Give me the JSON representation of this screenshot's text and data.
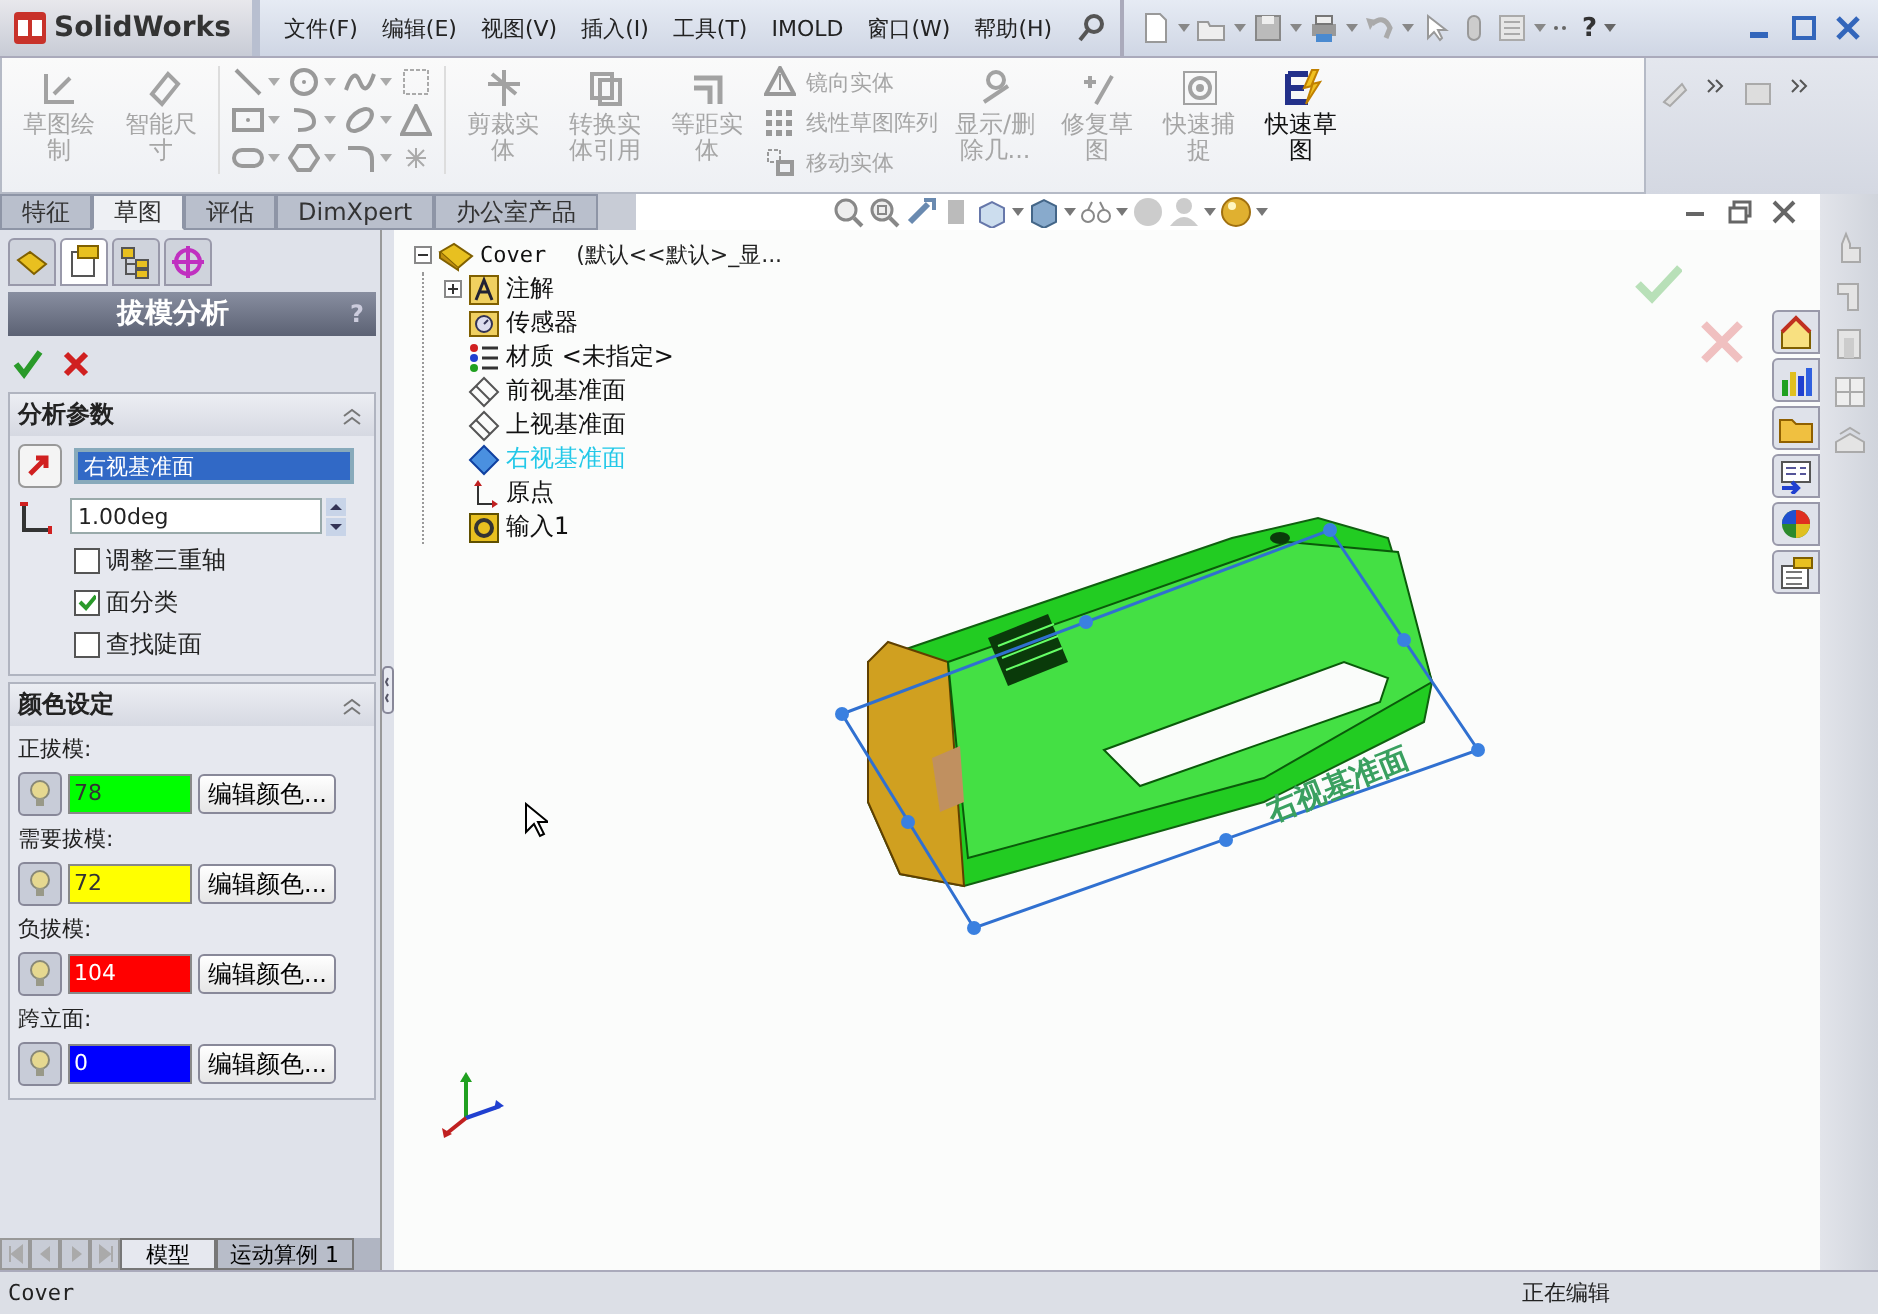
{
  "title_bar": {
    "logo": "SolidWorks",
    "menus": [
      "文件(F)",
      "编辑(E)",
      "视图(V)",
      "插入(I)",
      "工具(T)",
      "IMOLD",
      "窗口(W)",
      "帮助(H)"
    ],
    "help": "?"
  },
  "ribbon": {
    "tools": [
      {
        "kind": "large",
        "label": "草图绘制",
        "disabled": true
      },
      {
        "kind": "large",
        "label": "智能尺寸",
        "disabled": true
      },
      {
        "kind": "grid"
      },
      {
        "kind": "large",
        "label": "剪裁实体",
        "disabled": true
      },
      {
        "kind": "large",
        "label": "转换实体引用",
        "disabled": true
      },
      {
        "kind": "large",
        "label": "等距实体",
        "disabled": true
      },
      {
        "kind": "list",
        "items": [
          {
            "label": "镜向实体",
            "disabled": true
          },
          {
            "label": "线性草图阵列",
            "disabled": true
          },
          {
            "label": "移动实体",
            "disabled": true
          }
        ]
      },
      {
        "kind": "large",
        "label": "显示/删除几...",
        "disabled": true
      },
      {
        "kind": "large",
        "label": "修复草图",
        "disabled": true
      },
      {
        "kind": "large",
        "label": "快速捕捉",
        "disabled": true
      },
      {
        "kind": "large",
        "label": "快速草图",
        "disabled": false
      }
    ]
  },
  "tabs": [
    {
      "label": "特征",
      "selected": false
    },
    {
      "label": "草图",
      "selected": true
    },
    {
      "label": "评估",
      "selected": false
    },
    {
      "label": "DimXpert",
      "selected": false
    },
    {
      "label": "办公室产品",
      "selected": false
    }
  ],
  "property_manager": {
    "panel_tabs": [
      {
        "selected": false
      },
      {
        "selected": true
      },
      {
        "selected": false
      },
      {
        "selected": false
      }
    ],
    "title": "拔模分析",
    "help": "?",
    "sections": [
      {
        "kind": "parameters",
        "title": "分析参数",
        "direction": "右视基准面",
        "angle": "1.00deg",
        "options": [
          {
            "label": "调整三重轴",
            "checked": false
          },
          {
            "label": "面分类",
            "checked": true
          },
          {
            "label": "查找陡面",
            "checked": false
          }
        ]
      },
      {
        "kind": "colors",
        "title": "颜色设定",
        "colors": [
          {
            "label": "正拔模:",
            "count": "78",
            "color": "#00ff00",
            "button": "编辑颜色..."
          },
          {
            "label": "需要拔模:",
            "count": "72",
            "color": "#ffff00",
            "button": "编辑颜色..."
          },
          {
            "label": "负拔模:",
            "count": "104",
            "color": "#ff0000",
            "button": "编辑颜色..."
          },
          {
            "label": "跨立面:",
            "count": "0",
            "color": "#0000ff",
            "button": "编辑颜色..."
          }
        ]
      }
    ]
  },
  "feature_tree": {
    "label": "Cover",
    "config": "(默认<<默认>_显...",
    "expanded": true,
    "children": [
      {
        "kind": "annotations",
        "label": "注解",
        "expanded": false,
        "selected": false
      },
      {
        "kind": "sensors",
        "label": "传感器",
        "selected": false
      },
      {
        "kind": "material",
        "label": "材质 <未指定>",
        "selected": false
      },
      {
        "kind": "plane",
        "label": "前视基准面",
        "selected": false
      },
      {
        "kind": "plane",
        "label": "上视基准面",
        "selected": false
      },
      {
        "kind": "plane",
        "label": "右视基准面",
        "selected": true
      },
      {
        "kind": "origin",
        "label": "原点",
        "selected": false
      },
      {
        "kind": "import",
        "label": "输入1",
        "selected": false
      }
    ]
  },
  "viewport": {
    "plane_label": "右视基准面"
  },
  "bottom_tabs": [
    {
      "label": "模型",
      "selected": true
    },
    {
      "label": "运动算例 1",
      "selected": false
    }
  ],
  "status_bar": {
    "left": "Cover",
    "right": "正在编辑"
  }
}
